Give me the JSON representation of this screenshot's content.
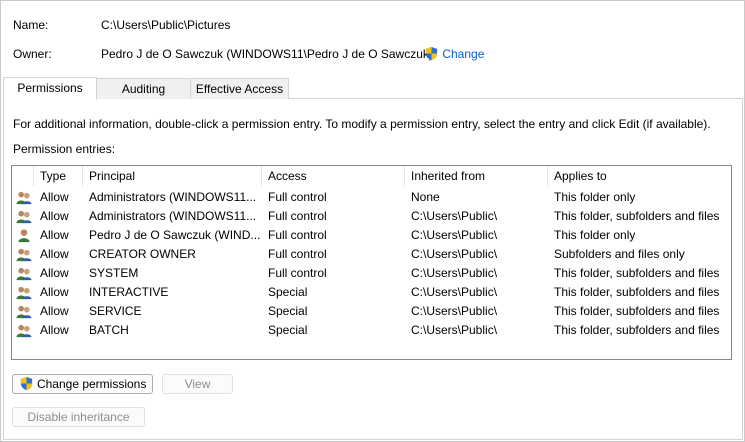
{
  "name": {
    "label": "Name:",
    "value": "C:\\Users\\Public\\Pictures"
  },
  "owner": {
    "label": "Owner:",
    "value": "Pedro J de O Sawczuk (WINDOWS11\\Pedro J de O Sawczuk)",
    "change_label": "Change"
  },
  "tabs": [
    {
      "label": "Permissions",
      "active": true
    },
    {
      "label": "Auditing",
      "active": false
    },
    {
      "label": "Effective Access",
      "active": false
    }
  ],
  "info_text": "For additional information, double-click a permission entry. To modify a permission entry, select the entry and click Edit (if available).",
  "entries_label": "Permission entries:",
  "columns": [
    "Type",
    "Principal",
    "Access",
    "Inherited from",
    "Applies to"
  ],
  "rows": [
    {
      "icon": "group-users-icon",
      "type": "Allow",
      "principal": "Administrators (WINDOWS11...",
      "access": "Full control",
      "inherited": "None",
      "applies": "This folder only"
    },
    {
      "icon": "group-users-icon",
      "type": "Allow",
      "principal": "Administrators (WINDOWS11...",
      "access": "Full control",
      "inherited": "C:\\Users\\Public\\",
      "applies": "This folder, subfolders and files"
    },
    {
      "icon": "single-user-icon",
      "type": "Allow",
      "principal": "Pedro J de O Sawczuk (WIND...",
      "access": "Full control",
      "inherited": "C:\\Users\\Public\\",
      "applies": "This folder only"
    },
    {
      "icon": "group-users-icon",
      "type": "Allow",
      "principal": "CREATOR OWNER",
      "access": "Full control",
      "inherited": "C:\\Users\\Public\\",
      "applies": "Subfolders and files only"
    },
    {
      "icon": "group-users-icon",
      "type": "Allow",
      "principal": "SYSTEM",
      "access": "Full control",
      "inherited": "C:\\Users\\Public\\",
      "applies": "This folder, subfolders and files"
    },
    {
      "icon": "group-users-icon",
      "type": "Allow",
      "principal": "INTERACTIVE",
      "access": "Special",
      "inherited": "C:\\Users\\Public\\",
      "applies": "This folder, subfolders and files"
    },
    {
      "icon": "group-users-icon",
      "type": "Allow",
      "principal": "SERVICE",
      "access": "Special",
      "inherited": "C:\\Users\\Public\\",
      "applies": "This folder, subfolders and files"
    },
    {
      "icon": "group-users-icon",
      "type": "Allow",
      "principal": "BATCH",
      "access": "Special",
      "inherited": "C:\\Users\\Public\\",
      "applies": "This folder, subfolders and files"
    }
  ],
  "buttons": {
    "change_permissions": "Change permissions",
    "view": "View",
    "disable_inheritance": "Disable inheritance"
  },
  "colors": {
    "link": "#0b5fc5",
    "shield_blue": "#2f6fd1",
    "shield_yellow": "#f4c20d"
  }
}
